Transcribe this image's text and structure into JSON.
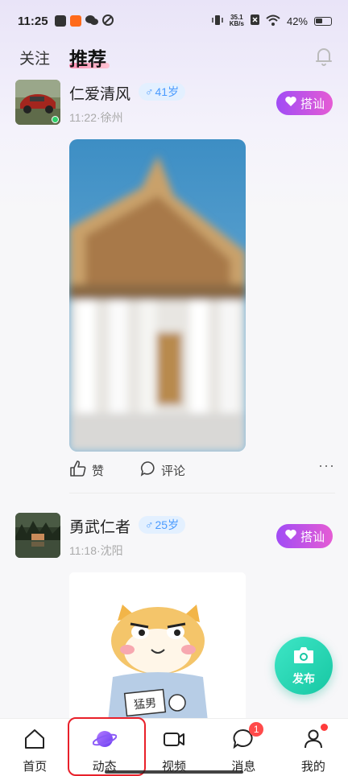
{
  "status_bar": {
    "time": "11:25",
    "netspeed_value": "35.1",
    "netspeed_unit": "KB/s",
    "battery": "42%"
  },
  "top_tabs": {
    "follow": "关注",
    "recommend": "推荐"
  },
  "posts": [
    {
      "username": "仁爱清风",
      "gender_symbol": "♂",
      "age": "41岁",
      "time": "11:22",
      "location": "徐州",
      "chat_label": "搭讪",
      "like_label": "赞",
      "comment_label": "评论",
      "more": "···",
      "online": true
    },
    {
      "username": "勇武仁者",
      "gender_symbol": "♂",
      "age": "25岁",
      "time": "11:18",
      "location": "沈阳",
      "chat_label": "搭讪",
      "sticker_text": "猛男"
    }
  ],
  "publish": {
    "label": "发布"
  },
  "bottom_nav": [
    {
      "label": "首页",
      "icon": "home-icon"
    },
    {
      "label": "动态",
      "icon": "planet-icon",
      "active": true
    },
    {
      "label": "视频",
      "icon": "video-camera-icon"
    },
    {
      "label": "消息",
      "icon": "message-bubble-icon",
      "badge": "1"
    },
    {
      "label": "我的",
      "icon": "person-icon",
      "dot": true
    }
  ],
  "colors": {
    "accent_purple": "#a14cf5",
    "accent_pink": "#e55cd4",
    "publish_green": "#17c7a3",
    "age_blue": "#4a9bff",
    "highlight_red": "#e8202a"
  }
}
